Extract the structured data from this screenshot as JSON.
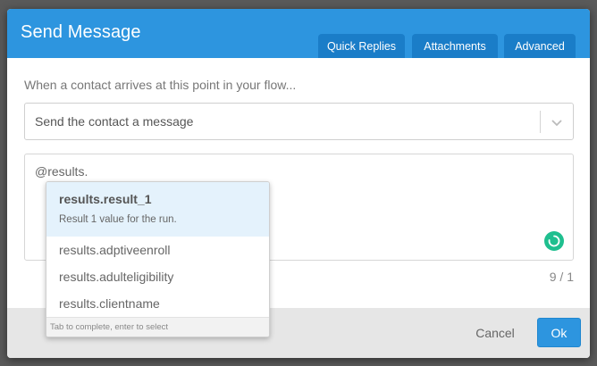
{
  "dialog": {
    "title": "Send Message",
    "tabs": [
      {
        "label": "Quick Replies"
      },
      {
        "label": "Attachments"
      },
      {
        "label": "Advanced"
      }
    ],
    "subtitle": "When a contact arrives at this point in your flow...",
    "action_select": {
      "value": "Send the contact a message"
    },
    "editor": {
      "text": "@results."
    },
    "counter": "9 / 1",
    "buttons": {
      "cancel": "Cancel",
      "ok": "Ok"
    },
    "colors": {
      "header": "#2d95df",
      "tab": "#1a7dc8",
      "spinner": "#1fbf8f"
    }
  },
  "autocomplete": {
    "selected": {
      "name": "results.result_1",
      "description": "Result 1 value for the run."
    },
    "items": [
      {
        "name": "results.adptiveenroll"
      },
      {
        "name": "results.adulteligibility"
      },
      {
        "name": "results.clientname"
      }
    ],
    "hint": "Tab to complete, enter to select"
  }
}
